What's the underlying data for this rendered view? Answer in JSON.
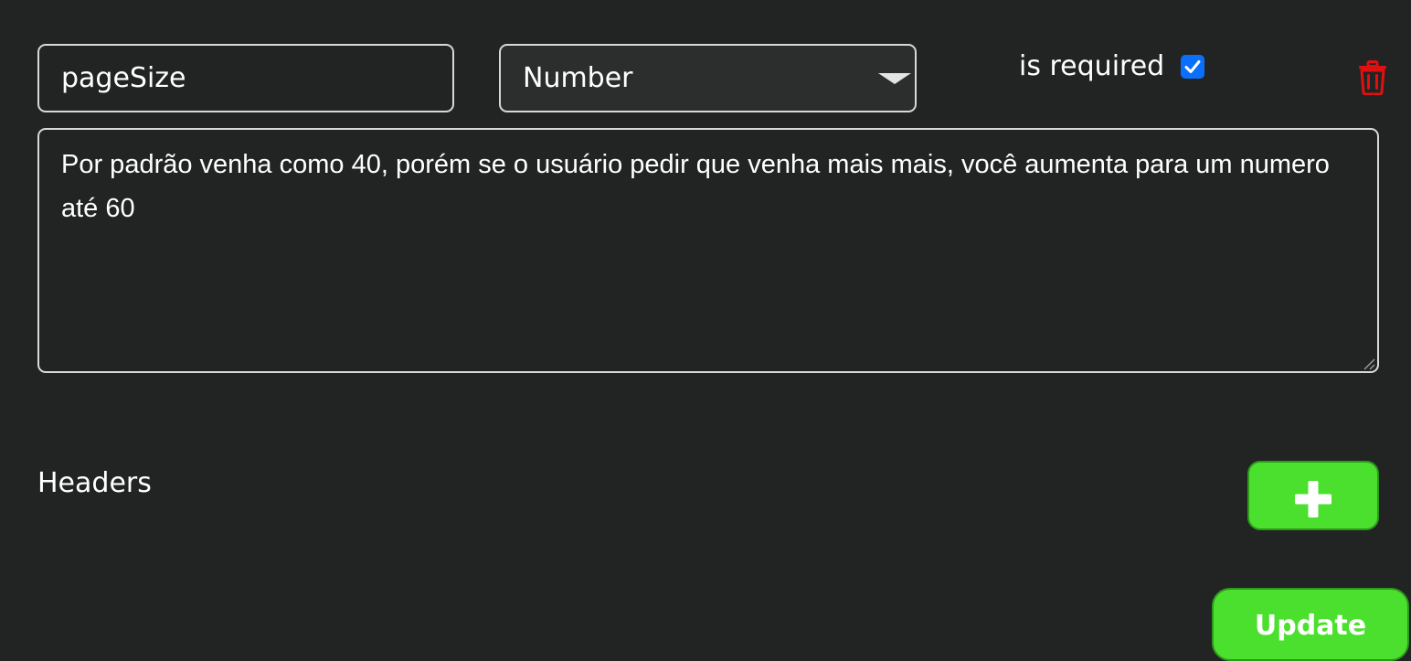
{
  "param": {
    "name_value": "pageSize",
    "type_value": "Number",
    "required_label": "is required",
    "required_checked": true,
    "description_value": "Por padrão venha como 40, porém se o usuário pedir que venha mais mais, você aumenta para um numero até 60"
  },
  "headers": {
    "label": "Headers"
  },
  "actions": {
    "update_label": "Update"
  },
  "icons": {
    "delete": "trash-icon",
    "add": "plus-icon",
    "check": "checkmark-icon",
    "dropdown": "caret-down-icon"
  },
  "colors": {
    "background": "#222423",
    "accent_green": "#4ce02e",
    "delete_red": "#e01010",
    "checkbox_blue": "#0a6ffb",
    "border": "#d8d8d8"
  }
}
